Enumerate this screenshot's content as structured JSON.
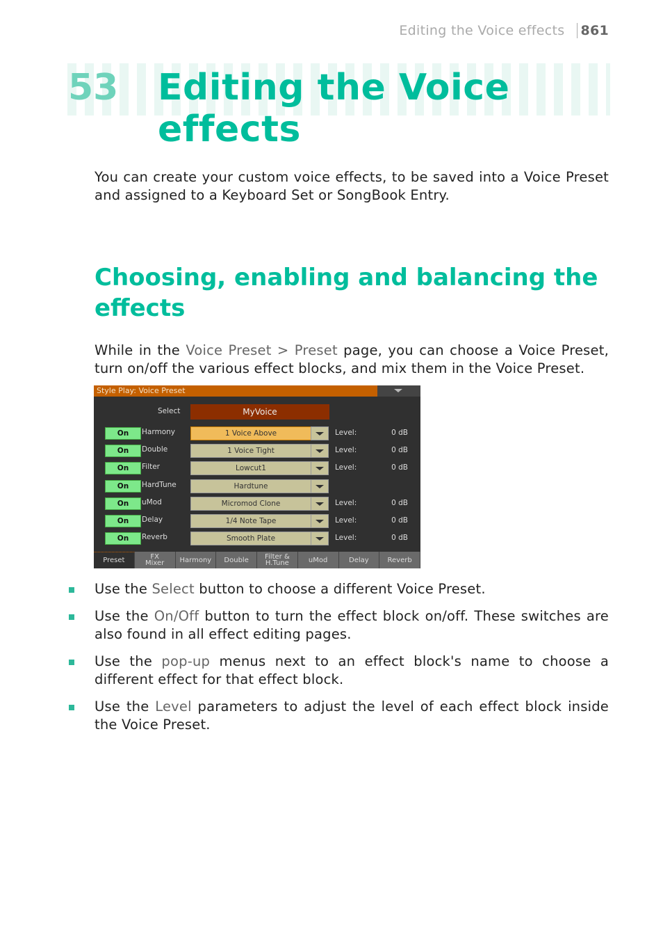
{
  "header": {
    "section": "Editing the Voice effects",
    "page": "861"
  },
  "chapter": {
    "number": "53",
    "title": "Editing the Voice effects"
  },
  "intro": "You can create your custom voice effects, to be saved into a Voice Preset and assigned to a Keyboard Set or SongBook Entry.",
  "section": {
    "title": "Choosing, enabling and balancing the effects",
    "para": {
      "a": "While in the ",
      "b": "Voice Preset > Preset",
      "c": " page, you can choose a Voice Preset, turn on/off the various effect blocks, and mix them in the Voice Preset."
    }
  },
  "screen": {
    "title": "Style Play: Voice Preset",
    "select_label": "Select",
    "select_value": "MyVoice",
    "rows": [
      {
        "on": "On",
        "name": "Harmony",
        "effect": "1 Voice Above",
        "level_label": "Level:",
        "level": "0 dB"
      },
      {
        "on": "On",
        "name": "Double",
        "effect": "1 Voice Tight",
        "level_label": "Level:",
        "level": "0 dB"
      },
      {
        "on": "On",
        "name": "Filter",
        "effect": "Lowcut1",
        "level_label": "Level:",
        "level": "0 dB"
      },
      {
        "on": "On",
        "name": "HardTune",
        "effect": "Hardtune"
      },
      {
        "on": "On",
        "name": "uMod",
        "effect": "Micromod Clone",
        "level_label": "Level:",
        "level": "0 dB"
      },
      {
        "on": "On",
        "name": "Delay",
        "effect": "1/4 Note Tape",
        "level_label": "Level:",
        "level": "0 dB"
      },
      {
        "on": "On",
        "name": "Reverb",
        "effect": "Smooth Plate",
        "level_label": "Level:",
        "level": "0 dB"
      }
    ],
    "tabs": [
      "Preset",
      "FX\nMixer",
      "Harmony",
      "Double",
      "Filter &\nH.Tune",
      "uMod",
      "Delay",
      "Reverb"
    ]
  },
  "bullets": [
    {
      "a": "Use the ",
      "b": "Select",
      "c": " button to choose a different Voice Preset."
    },
    {
      "a": "Use the ",
      "b": "On/Off",
      "c": " button to turn the effect block on/off. These switches are also found in all effect editing pages."
    },
    {
      "a": "Use the ",
      "b": "pop-up",
      "c": " menus next to an effect block's name to choose a different effect for that effect block."
    },
    {
      "a": "Use the ",
      "b": "Level",
      "c": " parameters to adjust the level of each effect block inside the Voice Preset."
    }
  ],
  "colors": {
    "accent": "#00bd9c",
    "title_bar": "#c46000",
    "on_button": "#7de88a"
  }
}
